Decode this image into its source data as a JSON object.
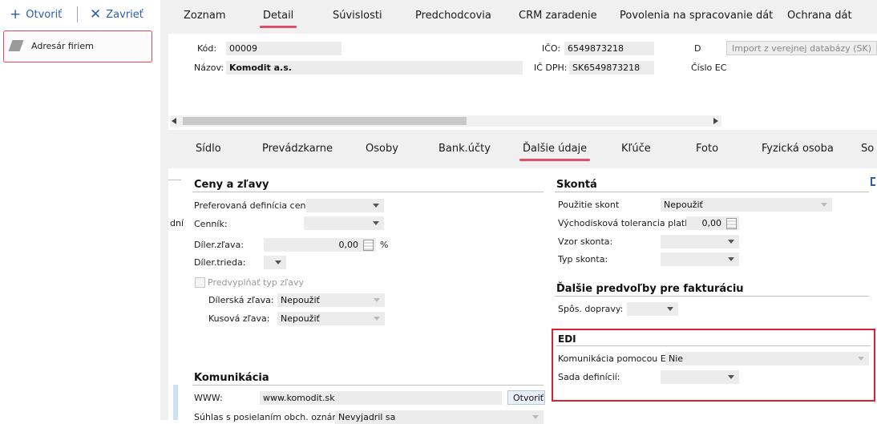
{
  "toolbar": {
    "open_label": "Otvoriť",
    "close_label": "Zavrieť",
    "open_icon": "plus-icon",
    "close_icon": "close-icon"
  },
  "tree": {
    "item_label": "Adresár firiem"
  },
  "top_tabs": [
    "Zoznam",
    "Detail",
    "Súvislosti",
    "Predchodcovia",
    "CRM zaradenie",
    "Povolenia na spracovanie dát",
    "Ochrana dát"
  ],
  "top_active": "Detail",
  "header": {
    "kod_label": "Kód:",
    "kod_value": "00009",
    "nazov_label": "Názov:",
    "nazov_value": "Komodit a.s.",
    "ico_label": "IČO:",
    "ico_value": "6549873218",
    "icdph_label": "IČ DPH:",
    "icdph_value": "SK6549873218",
    "d_label": "D",
    "cislo_label": "Číslo EC",
    "import_button": "Import z verejnej databázy (SK)"
  },
  "sub_tabs": [
    "Sídlo",
    "Prevádzkarne",
    "Osoby",
    "Bank.účty",
    "Ďalšie údaje",
    "Kľúče",
    "Foto",
    "Fyzická osoba",
    "So"
  ],
  "sub_active": "Ďalšie údaje",
  "left_edge_text": "dní",
  "ceny": {
    "title": "Ceny a zľavy",
    "pref_label": "Preferovaná definícia ceny:",
    "pref_value": "",
    "cennik_label": "Cenník:",
    "cennik_value": "",
    "diler_zlava_label": "Díler.zľava:",
    "diler_zlava_value": "0,00",
    "percent": "%",
    "diler_trieda_label": "Díler.trieda:",
    "diler_trieda_value": "",
    "predvyplnat_label": "Predvyplňať typ zľavy",
    "dilerska_label": "Dílerská zľava:",
    "dilerska_value": "Nepoužiť",
    "kusova_label": "Kusová zľava:",
    "kusova_value": "Nepoužiť"
  },
  "komunikacia": {
    "title": "Komunikácia",
    "www_label": "WWW:",
    "www_value": "www.komodit.sk",
    "open_button": "Otvoriť",
    "suhlas_label": "Súhlas s posielaním obch. oznámení",
    "suhlas_value": "Nevyjadril sa"
  },
  "skonta": {
    "title": "Skontá",
    "pouzitie_label": "Použitie skont",
    "pouzitie_value": "Nepoužiť",
    "tolerancia_label": "Východisková tolerancia platby:",
    "tolerancia_value": "0,00",
    "vzor_label": "Vzor skonta:",
    "vzor_value": "",
    "typ_label": "Typ skonta:",
    "typ_value": ""
  },
  "fakturacia": {
    "title": "Ďalšie predvoľby pre fakturáciu",
    "dopravy_label": "Spôs. dopravy:",
    "dopravy_value": ""
  },
  "edi": {
    "title": "EDI",
    "komunikacia_label": "Komunikácia pomocou EDI:",
    "komunikacia_value": "Nie",
    "sada_label": "Sada definícií:",
    "sada_value": ""
  },
  "colors": {
    "accent": "#e0506a",
    "highlight": "#d9222f",
    "link": "#2a5db0"
  }
}
